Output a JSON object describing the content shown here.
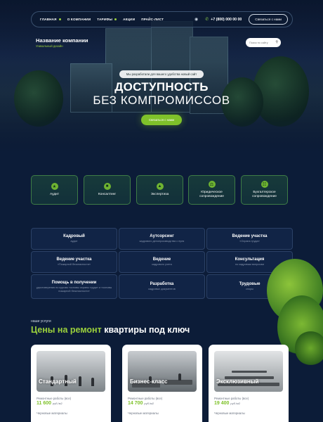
{
  "nav": {
    "items": [
      {
        "label": "ГЛАВНАЯ",
        "has_dropdown": true
      },
      {
        "label": "О КОМПАНИИ",
        "has_dropdown": false
      },
      {
        "label": "ТАРИФЫ",
        "has_dropdown": true
      },
      {
        "label": "АКЦИИ",
        "has_dropdown": false
      },
      {
        "label": "ПРАЙС-ЛИСТ",
        "has_dropdown": false
      }
    ],
    "phone": "+7 (800) 000 00 00",
    "cta": "Связаться с нами",
    "icons": [
      "eye-icon",
      "phone-icon"
    ]
  },
  "brand": {
    "name": "Название компании",
    "tagline": "Уникальный дизайн"
  },
  "search": {
    "placeholder": "Поиск по сайту"
  },
  "hero": {
    "pill": "Мы разработали для вашего удобства новый сайт",
    "title_line1": "ДОСТУПНОСТЬ",
    "title_line2": "БЕЗ КОМПРОМИССОВ",
    "cta": "Связаться с нами"
  },
  "services": [
    {
      "label": "Аудит",
      "icon": "audit-icon"
    },
    {
      "label": "Консалтинг",
      "icon": "consulting-icon"
    },
    {
      "label": "Экспертиза",
      "icon": "expertise-icon"
    },
    {
      "label": "Юридическое сопровождение",
      "icon": "legal-icon"
    },
    {
      "label": "Бухгалтерское сопровождение",
      "icon": "accounting-icon"
    }
  ],
  "grid": [
    {
      "title": "Кадровый",
      "sub": "аудит"
    },
    {
      "title": "Аутсорсинг",
      "sub": "кадрового делопроизводства с нуля"
    },
    {
      "title": "Ведение участка",
      "sub": "«Охрана труда»"
    },
    {
      "title": "Ведение участка",
      "sub": "«Пожарной безопасности»"
    },
    {
      "title": "Ведение",
      "sub": "кадрового учета"
    },
    {
      "title": "Консультация",
      "sub": "по кадровым вопросам"
    },
    {
      "title": "Помощь в получении",
      "sub": "удостоверения по курсам «основы охраны труда» и «основы пожарной безопасности»"
    },
    {
      "title": "Разработка",
      "sub": "кадровых документов"
    },
    {
      "title": "Трудовые",
      "sub": "споры"
    }
  ],
  "prices": {
    "kicker": "наши услуги",
    "title_green": "Цены на ремонт",
    "title_white": "квартиры под ключ",
    "cards": [
      {
        "title": "Стандартный",
        "line1": "Ремонтные работы (все)",
        "price": "11 600",
        "unit": "руб./м2",
        "line2": "Черновые материалы"
      },
      {
        "title": "Бизнес-класс",
        "line1": "Ремонтные работы (все)",
        "price": "14 700",
        "unit": "руб./м2",
        "line2": "Черновые материалы"
      },
      {
        "title": "Эксклюзивный",
        "line1": "Ремонтные работы (все)",
        "price": "19 400",
        "unit": "руб./м2",
        "line2": "Черновые материалы"
      }
    ]
  }
}
